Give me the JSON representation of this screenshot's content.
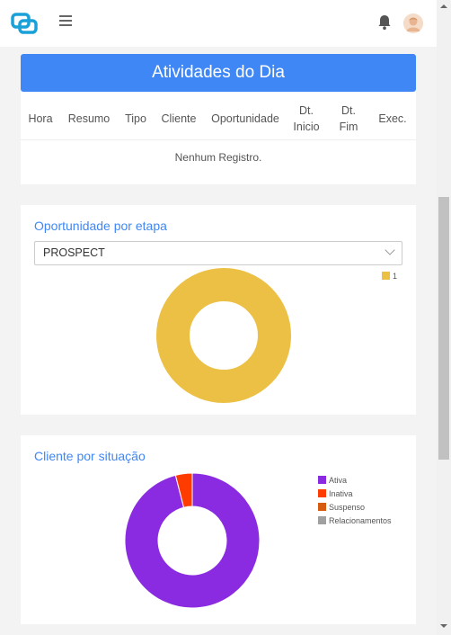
{
  "activities": {
    "title": "Atividades do Dia",
    "columns": [
      "Hora",
      "Resumo",
      "Tipo",
      "Cliente",
      "Oportunidade",
      "Dt.\nInicio",
      "Dt.\nFim",
      "Exec."
    ],
    "empty_message": "Nenhum Registro."
  },
  "opportunity": {
    "title": "Oportunidade por etapa",
    "select_value": "PROSPECT"
  },
  "client": {
    "title": "Cliente por situação"
  },
  "chart_data": [
    {
      "type": "pie",
      "title": "",
      "categories": [
        "1"
      ],
      "values": [
        1
      ],
      "colors": [
        "#ebc044"
      ],
      "legend": "top-right"
    },
    {
      "type": "pie",
      "title": "",
      "categories": [
        "Ativa",
        "Inativa",
        "Suspenso",
        "Relacionamentos"
      ],
      "values": [
        96,
        4,
        0,
        0
      ],
      "colors": [
        "#8a2be2",
        "#ff3c00",
        "#d65a0f",
        "#a0a0a0"
      ],
      "legend": "right"
    }
  ],
  "colors": {
    "primary": "#3f87f5",
    "background": "#f3f3f4"
  },
  "icons": {
    "logo": "logo-icon",
    "menu": "hamburger-icon",
    "notification": "bell-icon",
    "user": "avatar"
  }
}
